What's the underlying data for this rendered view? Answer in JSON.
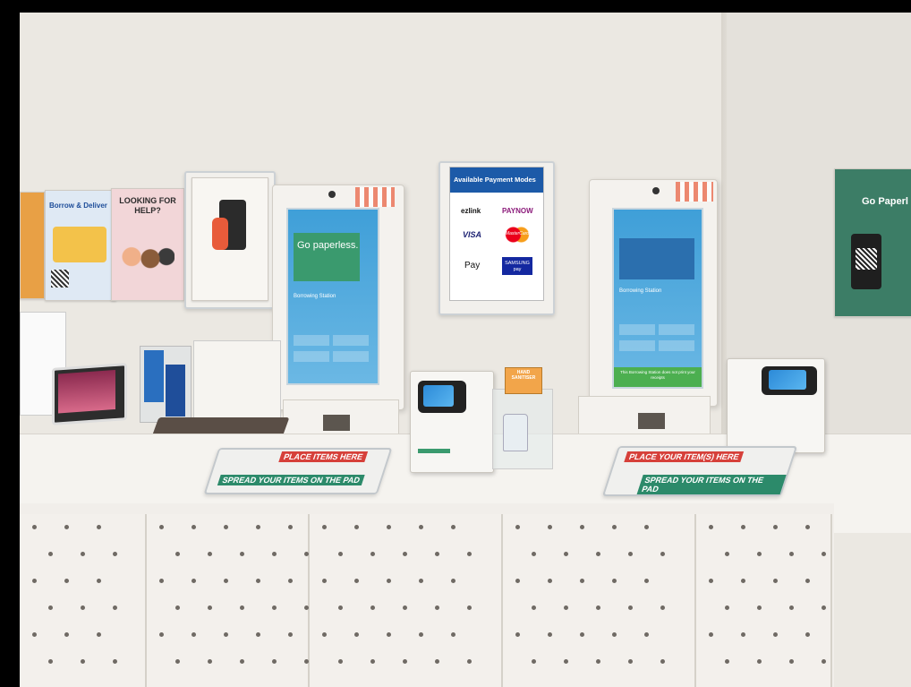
{
  "posters": {
    "borrow_deliver": {
      "title": "Borrow & Deliver"
    },
    "looking_for_help": {
      "title": "LOOKING FOR HELP?"
    },
    "go_paperless_right": {
      "title": "Go Paperl"
    }
  },
  "payment_sign": {
    "title": "Available Payment Modes",
    "methods": [
      "ezlink",
      "PAYNOW",
      "VISA",
      "MasterCard",
      "Pay",
      "SAMSUNG pay"
    ]
  },
  "kiosk_left": {
    "screen_headline": "Go paperless.",
    "section_label": "Borrowing Station"
  },
  "kiosk_right": {
    "section_label": "Borrowing Station",
    "footer_label": "This Borrowing Station does not print your receipts"
  },
  "hand_sanitiser": {
    "label": "HAND SANITISER"
  },
  "counter_mats": {
    "left": {
      "top": "PLACE ITEMS HERE",
      "bottom": "SPREAD YOUR ITEMS ON THE PAD"
    },
    "right": {
      "top": "PLACE YOUR ITEM(S) HERE",
      "bottom": "SPREAD YOUR ITEMS ON THE PAD"
    }
  },
  "colors": {
    "screen_blue": "#3f9fd8",
    "payment_header": "#1c5aa8",
    "mat_red": "#d6403a",
    "mat_green": "#2c8a6a",
    "poster_green": "#3c7d66"
  }
}
